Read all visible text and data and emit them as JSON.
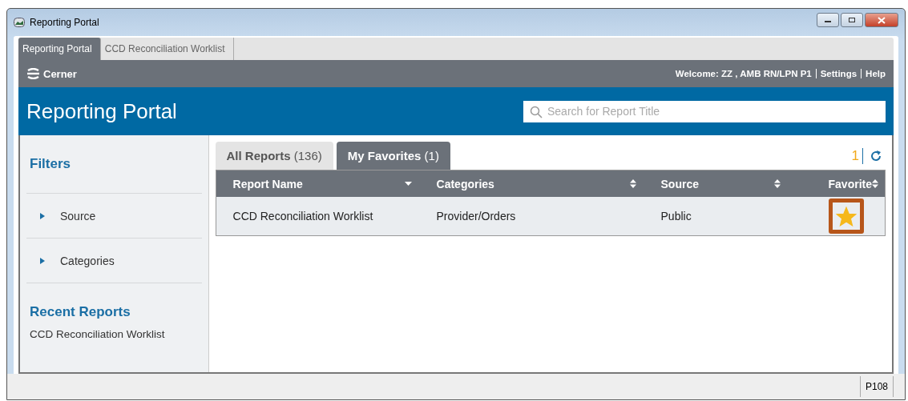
{
  "window": {
    "title": "Reporting Portal"
  },
  "app_tabs": [
    {
      "label": "Reporting Portal",
      "selected": true
    },
    {
      "label": "CCD Reconciliation Worklist",
      "selected": false
    }
  ],
  "brand": "Cerner",
  "user_bar": {
    "welcome": "Welcome: ZZ , AMB RN/LPN P1",
    "links": [
      "Settings",
      "Help"
    ]
  },
  "header": {
    "title": "Reporting Portal",
    "search": {
      "placeholder": "Search for Report Title"
    }
  },
  "sidebar": {
    "filters_title": "Filters",
    "filters": [
      {
        "label": "Source",
        "expanded": false
      },
      {
        "label": "Categories",
        "expanded": false
      }
    ],
    "recent_title": "Recent Reports",
    "recent": [
      "CCD Reconciliation Worklist"
    ]
  },
  "report_tabs": [
    {
      "label": "All Reports",
      "count": "(136)",
      "selected": false
    },
    {
      "label": "My Favorites",
      "count": "(1)",
      "selected": true
    }
  ],
  "result_count": "1",
  "table": {
    "columns": [
      {
        "label": "Report Name",
        "kind": "sorted_desc"
      },
      {
        "label": "Categories",
        "kind": "sortable"
      },
      {
        "label": "Source",
        "kind": "sortable"
      },
      {
        "label": "Favorite",
        "kind": "sortable"
      }
    ],
    "rows": [
      {
        "name": "CCD Reconciliation Worklist",
        "category": "Provider/Orders",
        "source": "Public",
        "favorite": true,
        "highlighted": true
      }
    ]
  },
  "status_bar": {
    "code": "P108"
  }
}
